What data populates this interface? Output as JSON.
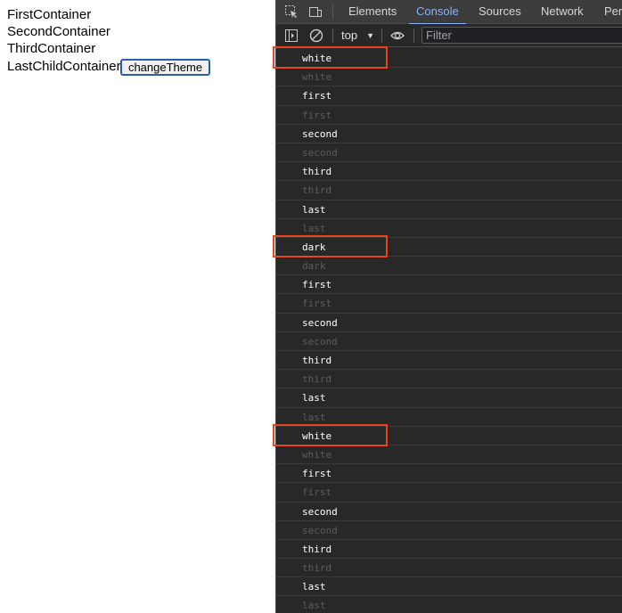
{
  "page": {
    "lines": [
      "FirstContainer",
      "SecondContainer",
      "ThirdContainer",
      "LastChildContainer"
    ],
    "button_label": "changeTheme"
  },
  "devtools": {
    "tabs": [
      "Elements",
      "Console",
      "Sources",
      "Network",
      "Per"
    ],
    "active_tab": "Console",
    "context": "top",
    "filter_placeholder": "Filter",
    "icons": [
      "inspect-icon",
      "device-toolbar-icon",
      "sidebar-toggle-icon",
      "clear-console-icon",
      "eye-icon"
    ],
    "accent_color": "#8ab4f8",
    "highlight_color": "#e8441f"
  },
  "console": {
    "entries": [
      {
        "text": "white",
        "dim": false,
        "highlight": true
      },
      {
        "text": "white",
        "dim": true
      },
      {
        "text": "first",
        "dim": false
      },
      {
        "text": "first",
        "dim": true
      },
      {
        "text": "second",
        "dim": false
      },
      {
        "text": "second",
        "dim": true
      },
      {
        "text": "third",
        "dim": false
      },
      {
        "text": "third",
        "dim": true
      },
      {
        "text": "last",
        "dim": false
      },
      {
        "text": "last",
        "dim": true
      },
      {
        "text": "dark",
        "dim": false,
        "highlight": true
      },
      {
        "text": "dark",
        "dim": true
      },
      {
        "text": "first",
        "dim": false
      },
      {
        "text": "first",
        "dim": true
      },
      {
        "text": "second",
        "dim": false
      },
      {
        "text": "second",
        "dim": true
      },
      {
        "text": "third",
        "dim": false
      },
      {
        "text": "third",
        "dim": true
      },
      {
        "text": "last",
        "dim": false
      },
      {
        "text": "last",
        "dim": true
      },
      {
        "text": "white",
        "dim": false,
        "highlight": true
      },
      {
        "text": "white",
        "dim": true
      },
      {
        "text": "first",
        "dim": false
      },
      {
        "text": "first",
        "dim": true
      },
      {
        "text": "second",
        "dim": false
      },
      {
        "text": "second",
        "dim": true
      },
      {
        "text": "third",
        "dim": false
      },
      {
        "text": "third",
        "dim": true
      },
      {
        "text": "last",
        "dim": false
      },
      {
        "text": "last",
        "dim": true
      }
    ]
  }
}
